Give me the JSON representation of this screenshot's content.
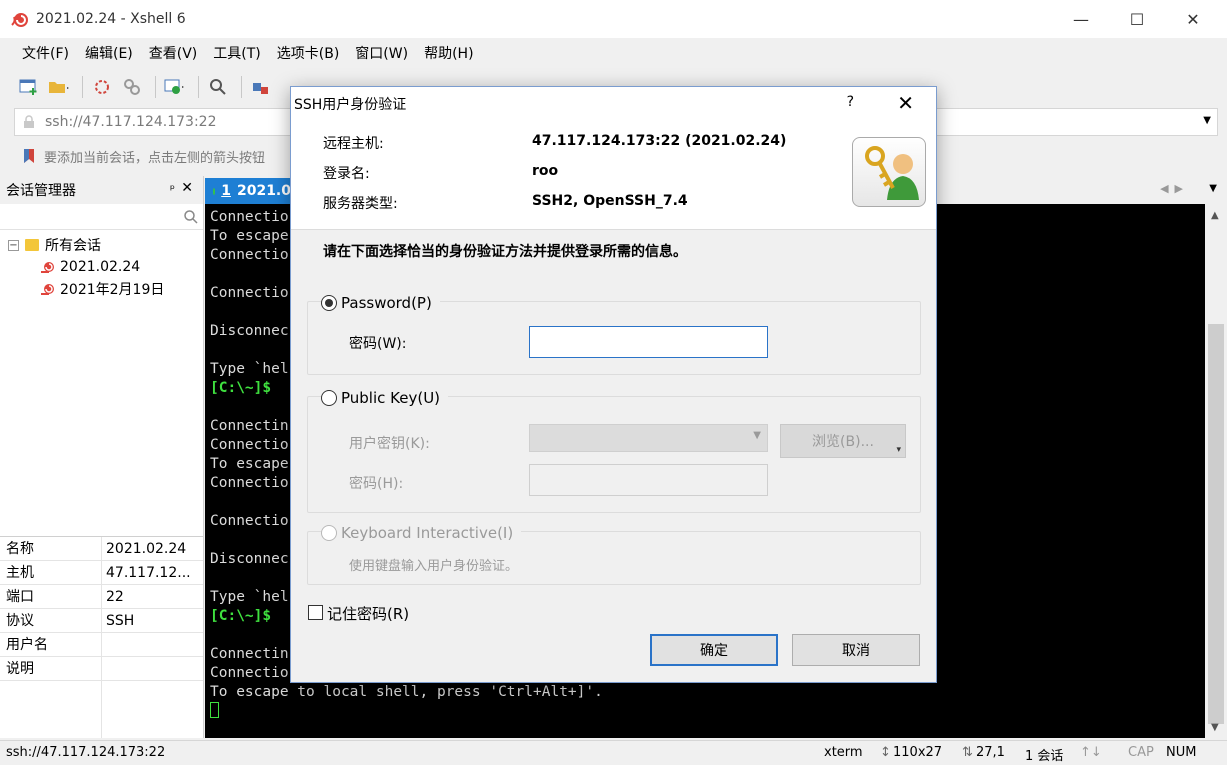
{
  "window": {
    "title": "2021.02.24 - Xshell 6",
    "minimize": "—",
    "maximize": "☐",
    "close": "✕"
  },
  "menu": [
    "文件(F)",
    "编辑(E)",
    "查看(V)",
    "工具(T)",
    "选项卡(B)",
    "窗口(W)",
    "帮助(H)"
  ],
  "address": {
    "value": "ssh://47.117.124.173:22"
  },
  "hint": {
    "text": "要添加当前会话，点击左侧的箭头按钮"
  },
  "session_manager": {
    "title": "会话管理器",
    "pin": "ᵖ",
    "close": "✕",
    "tree": {
      "root_expander": "−",
      "root": "所有会话",
      "items": [
        "2021.02.24",
        "2021年2月19日"
      ]
    },
    "props": [
      {
        "key": "名称",
        "value": "2021.02.24"
      },
      {
        "key": "主机",
        "value": "47.117.12..."
      },
      {
        "key": "端口",
        "value": "22"
      },
      {
        "key": "协议",
        "value": "SSH"
      },
      {
        "key": "用户名",
        "value": ""
      },
      {
        "key": "说明",
        "value": ""
      }
    ]
  },
  "tab": {
    "number": "1",
    "label": "2021.0"
  },
  "terminal": {
    "lines": [
      "Connection",
      "To escape",
      "Connection",
      "",
      "Connection",
      "",
      "Disconnec",
      "",
      "Type `hel",
      "[C:\\~]$",
      "",
      "Connectin",
      "Connection",
      "To escape",
      "Connection",
      "",
      "Connection",
      "",
      "Disconnec",
      "",
      "Type `hel",
      "[C:\\~]$",
      "",
      "Connectin",
      "Connection",
      "To escape to local shell, press 'Ctrl+Alt+]'."
    ]
  },
  "statusbar": {
    "address": "ssh://47.117.124.173:22",
    "term": "xterm",
    "size": "110x27",
    "cursor": "27,1",
    "sessions": "1 会话",
    "cap": "CAP",
    "num": "NUM"
  },
  "dialog": {
    "title": "SSH用户身份验证",
    "help": "?",
    "close": "✕",
    "remote_host_label": "远程主机:",
    "remote_host_value": "47.117.124.173:22 (2021.02.24)",
    "login_label": "登录名:",
    "login_value": "roo",
    "server_type_label": "服务器类型:",
    "server_type_value": "SSH2, OpenSSH_7.4",
    "heading": "请在下面选择恰当的身份验证方法并提供登录所需的信息。",
    "password_option": "Password(P)",
    "password_label": "密码(W):",
    "public_key_option": "Public Key(U)",
    "user_key_label": "用户密钥(K):",
    "browse_button": "浏览(B)...",
    "key_password_label": "密码(H):",
    "keyboard_option": "Keyboard Interactive(I)",
    "keyboard_desc": "使用键盘输入用户身份验证。",
    "remember_label": "记住密码(R)",
    "ok": "确定",
    "cancel": "取消"
  },
  "colors": {
    "tab_blue": "#1e7fd4",
    "prompt_green": "#3fe03f",
    "focus_blue": "#2a73c8"
  }
}
